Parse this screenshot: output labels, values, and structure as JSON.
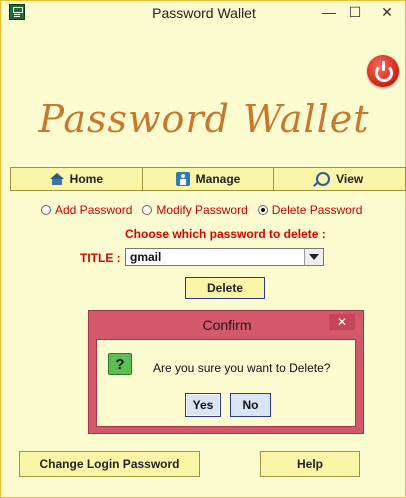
{
  "window": {
    "title": "Password Wallet",
    "minimize_glyph": "—",
    "maximize_glyph": "☐",
    "close_glyph": "✕",
    "app_icon": "wallet-app-icon"
  },
  "logo": {
    "text": "Password Wallet"
  },
  "power_icon": "power-icon",
  "nav": {
    "home_label": "Home",
    "manage_label": "Manage",
    "view_label": "View"
  },
  "mode": {
    "options": [
      "Add Password",
      "Modify Password",
      "Delete Password"
    ],
    "selected": "Delete Password"
  },
  "delete_form": {
    "prompt": "Choose which password to delete :",
    "title_label": "TITLE :",
    "selected_title": "gmail",
    "delete_label": "Delete"
  },
  "confirm_dialog": {
    "title": "Confirm",
    "close_glyph": "✕",
    "icon_glyph": "?",
    "message": "Are you sure you want to Delete?",
    "yes_label": "Yes",
    "no_label": "No"
  },
  "footer": {
    "change_login_label": "Change Login Password",
    "help_label": "Help"
  }
}
